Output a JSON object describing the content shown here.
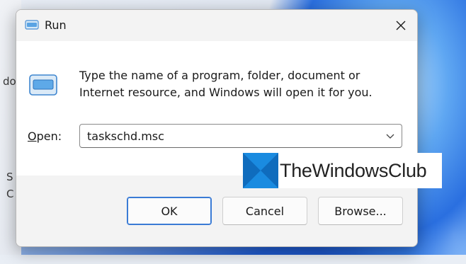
{
  "window": {
    "title": "Run"
  },
  "dialog": {
    "description": "Type the name of a program, folder, document or Internet resource, and Windows will open it for you.",
    "open_label_prefix": "O",
    "open_label_rest": "pen:",
    "open_value": "taskschd.msc"
  },
  "buttons": {
    "ok": "OK",
    "cancel": "Cancel",
    "browse": "Browse..."
  },
  "desktop": {
    "fragments": [
      "do",
      "S",
      "C"
    ]
  },
  "watermark": {
    "text": "TheWindowsClub"
  },
  "colors": {
    "accent": "#3a7bd5",
    "watermark_blue": "#1a8be0"
  }
}
